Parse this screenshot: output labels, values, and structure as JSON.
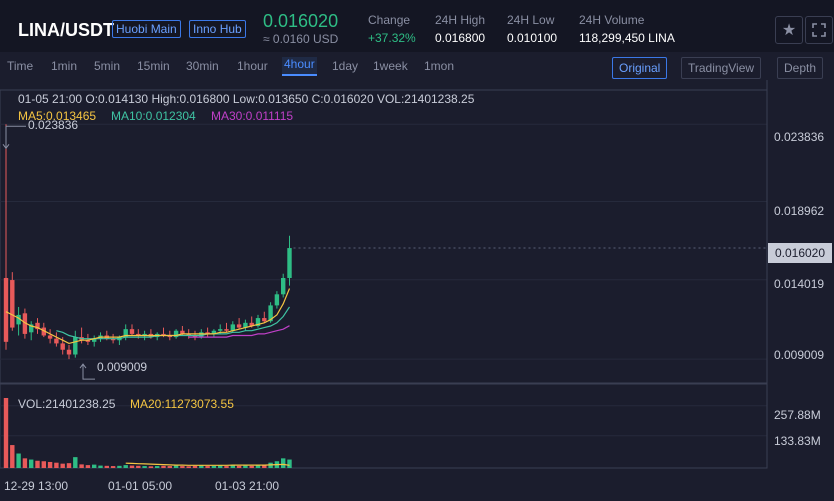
{
  "header": {
    "pair": "LINA/USDT",
    "tags": [
      "Huobi Main",
      "Inno Hub"
    ],
    "price": "0.016020",
    "price_usd": "≈ 0.0160 USD",
    "stats": [
      {
        "label": "Change",
        "value": "+37.32%"
      },
      {
        "label": "24H High",
        "value": "0.016800"
      },
      {
        "label": "24H Low",
        "value": "0.010100"
      },
      {
        "label": "24H Volume",
        "value": "118,299,450 LINA"
      }
    ],
    "colors": {
      "up": "#2ebd85",
      "down": "#e85a5a",
      "accent": "#3b78e7"
    }
  },
  "toolbar": {
    "timeframes": [
      "Time",
      "1min",
      "5min",
      "15min",
      "30min",
      "1hour",
      "4hour",
      "1day",
      "1week",
      "1mon"
    ],
    "active_timeframe": "4hour",
    "views": [
      "Original",
      "TradingView",
      "Depth"
    ],
    "active_view": "Original"
  },
  "info": {
    "ohlc": "01-05 21:00   O:0.014130   High:0.016800   Low:0.013650   C:0.016020   VOL:21401238.25",
    "ma5": "MA5:0.013465",
    "ma10": "MA10:0.012304",
    "ma30": "MA30:0.011115",
    "vol": "VOL:21401238.25",
    "vol_ma20": "MA20:11273073.55",
    "high_mark": "0.023836",
    "low_mark": "0.009009",
    "current_price": "0.016020"
  },
  "chart_data": {
    "type": "line",
    "y_ticks": [
      "0.023836",
      "0.018962",
      "0.014019",
      "0.009009"
    ],
    "y_tick_values": [
      0.023836,
      0.018962,
      0.014019,
      0.009009
    ],
    "vol_ticks": [
      "257.88M",
      "133.83M"
    ],
    "vol_tick_values": [
      257.88,
      133.83
    ],
    "x_ticks": [
      "12-29 13:00",
      "01-01 05:00",
      "01-03 21:00"
    ],
    "ylim": [
      0.0075,
      0.026
    ],
    "vol_max": 290,
    "ohlc": [
      [
        0.01413,
        0.023836,
        0.0096,
        0.0101
      ],
      [
        0.014,
        0.0145,
        0.0108,
        0.011
      ],
      [
        0.0112,
        0.0123,
        0.0105,
        0.0118
      ],
      [
        0.0119,
        0.0122,
        0.0103,
        0.0106
      ],
      [
        0.0107,
        0.0114,
        0.0102,
        0.0112
      ],
      [
        0.0113,
        0.0116,
        0.0106,
        0.0109
      ],
      [
        0.011,
        0.0113,
        0.0104,
        0.0105
      ],
      [
        0.0105,
        0.0109,
        0.01,
        0.0103
      ],
      [
        0.0103,
        0.0107,
        0.0098,
        0.01
      ],
      [
        0.01,
        0.0104,
        0.0093,
        0.0096
      ],
      [
        0.0096,
        0.0099,
        0.009009,
        0.0093
      ],
      [
        0.0093,
        0.0108,
        0.0091,
        0.0104
      ],
      [
        0.0104,
        0.011,
        0.01,
        0.0102
      ],
      [
        0.0102,
        0.0106,
        0.0099,
        0.0101
      ],
      [
        0.0101,
        0.0105,
        0.0098,
        0.0103
      ],
      [
        0.0103,
        0.0107,
        0.0101,
        0.0105
      ],
      [
        0.0105,
        0.0108,
        0.0102,
        0.0103
      ],
      [
        0.0103,
        0.0106,
        0.01,
        0.0102
      ],
      [
        0.0102,
        0.0105,
        0.0099,
        0.0104
      ],
      [
        0.0104,
        0.0112,
        0.0102,
        0.0109
      ],
      [
        0.0109,
        0.0112,
        0.0105,
        0.0106
      ],
      [
        0.0106,
        0.0109,
        0.0103,
        0.0105
      ],
      [
        0.0105,
        0.0108,
        0.0102,
        0.0106
      ],
      [
        0.0106,
        0.0109,
        0.0103,
        0.0104
      ],
      [
        0.0104,
        0.0107,
        0.0102,
        0.0106
      ],
      [
        0.0106,
        0.011,
        0.0104,
        0.0105
      ],
      [
        0.0105,
        0.0108,
        0.0102,
        0.0104
      ],
      [
        0.0104,
        0.0109,
        0.0103,
        0.0108
      ],
      [
        0.0108,
        0.0111,
        0.0105,
        0.0106
      ],
      [
        0.0106,
        0.0109,
        0.0103,
        0.0105
      ],
      [
        0.0105,
        0.0108,
        0.0102,
        0.0104
      ],
      [
        0.0104,
        0.0109,
        0.0103,
        0.0107
      ],
      [
        0.0107,
        0.011,
        0.0104,
        0.0106
      ],
      [
        0.0106,
        0.0109,
        0.0104,
        0.0108
      ],
      [
        0.0108,
        0.0112,
        0.0106,
        0.0109
      ],
      [
        0.0109,
        0.0113,
        0.0107,
        0.0108
      ],
      [
        0.0108,
        0.0114,
        0.0107,
        0.0112
      ],
      [
        0.0112,
        0.0116,
        0.0109,
        0.011
      ],
      [
        0.011,
        0.0115,
        0.0108,
        0.0113
      ],
      [
        0.0113,
        0.0117,
        0.011,
        0.0111
      ],
      [
        0.0111,
        0.0118,
        0.011,
        0.0116
      ],
      [
        0.0116,
        0.012,
        0.0113,
        0.0114
      ],
      [
        0.0114,
        0.0126,
        0.0113,
        0.0124
      ],
      [
        0.0124,
        0.0133,
        0.0122,
        0.0131
      ],
      [
        0.0131,
        0.0144,
        0.0129,
        0.01413
      ],
      [
        0.01413,
        0.0168,
        0.01365,
        0.01602
      ]
    ],
    "ma5": [
      0.012,
      0.0118,
      0.0116,
      0.0113,
      0.0111,
      0.011,
      0.0108,
      0.0106,
      0.0104,
      0.0102,
      0.01,
      0.0101,
      0.0102,
      0.0102,
      0.0103,
      0.0104,
      0.0104,
      0.0104,
      0.0104,
      0.0105,
      0.0105,
      0.0105,
      0.0105,
      0.0105,
      0.0105,
      0.0105,
      0.0105,
      0.0105,
      0.0106,
      0.0106,
      0.0106,
      0.0106,
      0.0106,
      0.0106,
      0.0107,
      0.0107,
      0.0108,
      0.0109,
      0.011,
      0.0111,
      0.0112,
      0.0113,
      0.0115,
      0.0118,
      0.0125,
      0.013465
    ],
    "ma10": [
      null,
      null,
      null,
      null,
      null,
      null,
      null,
      null,
      0.0108,
      0.0107,
      0.0105,
      0.0104,
      0.0103,
      0.0103,
      0.0103,
      0.0103,
      0.0103,
      0.0103,
      0.0103,
      0.0104,
      0.0104,
      0.0104,
      0.0104,
      0.0104,
      0.0105,
      0.0105,
      0.0105,
      0.0105,
      0.0105,
      0.0105,
      0.0105,
      0.0105,
      0.0106,
      0.0106,
      0.0106,
      0.0106,
      0.0107,
      0.0107,
      0.0108,
      0.0108,
      0.0109,
      0.011,
      0.0111,
      0.0113,
      0.0117,
      0.012304
    ],
    "ma30": [
      null,
      null,
      null,
      null,
      null,
      null,
      null,
      null,
      null,
      null,
      null,
      null,
      null,
      null,
      null,
      null,
      null,
      null,
      null,
      null,
      null,
      null,
      null,
      null,
      null,
      null,
      null,
      null,
      null,
      0.0104,
      0.0104,
      0.0104,
      0.0104,
      0.0104,
      0.0104,
      0.0104,
      0.0105,
      0.0105,
      0.0105,
      0.0105,
      0.0106,
      0.0106,
      0.0107,
      0.0108,
      0.0109,
      0.011115
    ],
    "volume": [
      290,
      95,
      60,
      40,
      35,
      30,
      28,
      25,
      22,
      18,
      20,
      45,
      15,
      12,
      14,
      10,
      9,
      8,
      9,
      12,
      10,
      9,
      8,
      7,
      8,
      9,
      8,
      10,
      8,
      7,
      9,
      10,
      8,
      9,
      10,
      8,
      11,
      9,
      10,
      9,
      14,
      12,
      22,
      28,
      40,
      35
    ],
    "vol_ma20": [
      null,
      null,
      null,
      null,
      null,
      null,
      null,
      null,
      null,
      null,
      null,
      null,
      null,
      null,
      null,
      null,
      null,
      null,
      null,
      20,
      19,
      18,
      17,
      16,
      15,
      14,
      13,
      12,
      12,
      11,
      11,
      11,
      11,
      11,
      11,
      11,
      12,
      12,
      12,
      12,
      12,
      12,
      13,
      14,
      15,
      11.27
    ],
    "series": [
      {
        "name": "MA5",
        "color": "#f5c542"
      },
      {
        "name": "MA10",
        "color": "#3fc3a3"
      },
      {
        "name": "MA30",
        "color": "#c040c8"
      },
      {
        "name": "MA20",
        "color": "#f5c542"
      }
    ]
  }
}
